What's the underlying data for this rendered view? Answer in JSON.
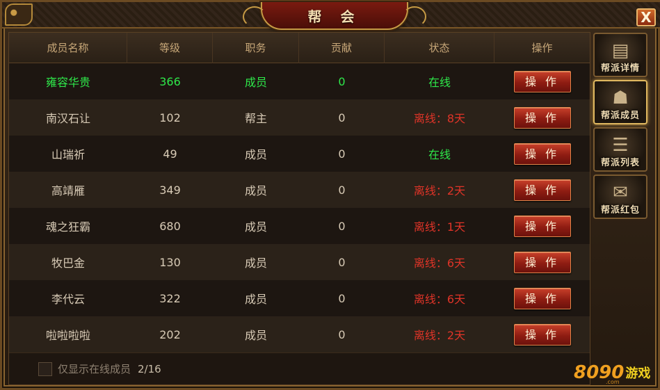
{
  "window": {
    "title": "帮 会",
    "close_label": "X"
  },
  "table": {
    "headers": [
      "成员名称",
      "等级",
      "职务",
      "贡献",
      "状态",
      "操作"
    ],
    "rows": [
      {
        "name": "雍容华贵",
        "level": "366",
        "role": "成员",
        "contribution": "0",
        "status": "在线",
        "status_type": "online",
        "action": "操 作",
        "self": true
      },
      {
        "name": "南汉石让",
        "level": "102",
        "role": "帮主",
        "contribution": "0",
        "status": "离线：8天",
        "status_type": "offline",
        "action": "操 作",
        "self": false
      },
      {
        "name": "山瑞祈",
        "level": "49",
        "role": "成员",
        "contribution": "0",
        "status": "在线",
        "status_type": "online",
        "action": "操 作",
        "self": false
      },
      {
        "name": "高靖雁",
        "level": "349",
        "role": "成员",
        "contribution": "0",
        "status": "离线：2天",
        "status_type": "offline",
        "action": "操 作",
        "self": false
      },
      {
        "name": "魂之狂霸",
        "level": "680",
        "role": "成员",
        "contribution": "0",
        "status": "离线：1天",
        "status_type": "offline",
        "action": "操 作",
        "self": false
      },
      {
        "name": "牧巴金",
        "level": "130",
        "role": "成员",
        "contribution": "0",
        "status": "离线：6天",
        "status_type": "offline",
        "action": "操 作",
        "self": false
      },
      {
        "name": "李代云",
        "level": "322",
        "role": "成员",
        "contribution": "0",
        "status": "离线：6天",
        "status_type": "offline",
        "action": "操 作",
        "self": false
      },
      {
        "name": "啦啦啦啦",
        "level": "202",
        "role": "成员",
        "contribution": "0",
        "status": "离线：2天",
        "status_type": "offline",
        "action": "操 作",
        "self": false
      }
    ]
  },
  "footer": {
    "filter_label": "仅显示在线成员",
    "count": "2/16",
    "filter_checked": false
  },
  "side_tabs": [
    {
      "label": "帮派详情",
      "icon": "book-icon",
      "active": false
    },
    {
      "label": "帮派成员",
      "icon": "helmet-icon",
      "active": true
    },
    {
      "label": "帮派列表",
      "icon": "scroll-icon",
      "active": false
    },
    {
      "label": "帮派红包",
      "icon": "red-envelope-icon",
      "active": false
    }
  ],
  "watermark": {
    "number": "8090",
    "text": "游戏",
    "domain": ".com"
  },
  "colors": {
    "online": "#2ee84a",
    "offline": "#e03428",
    "self_name": "#2ee84a",
    "header_text": "#c7a778",
    "button_red": "#8e1c12"
  }
}
